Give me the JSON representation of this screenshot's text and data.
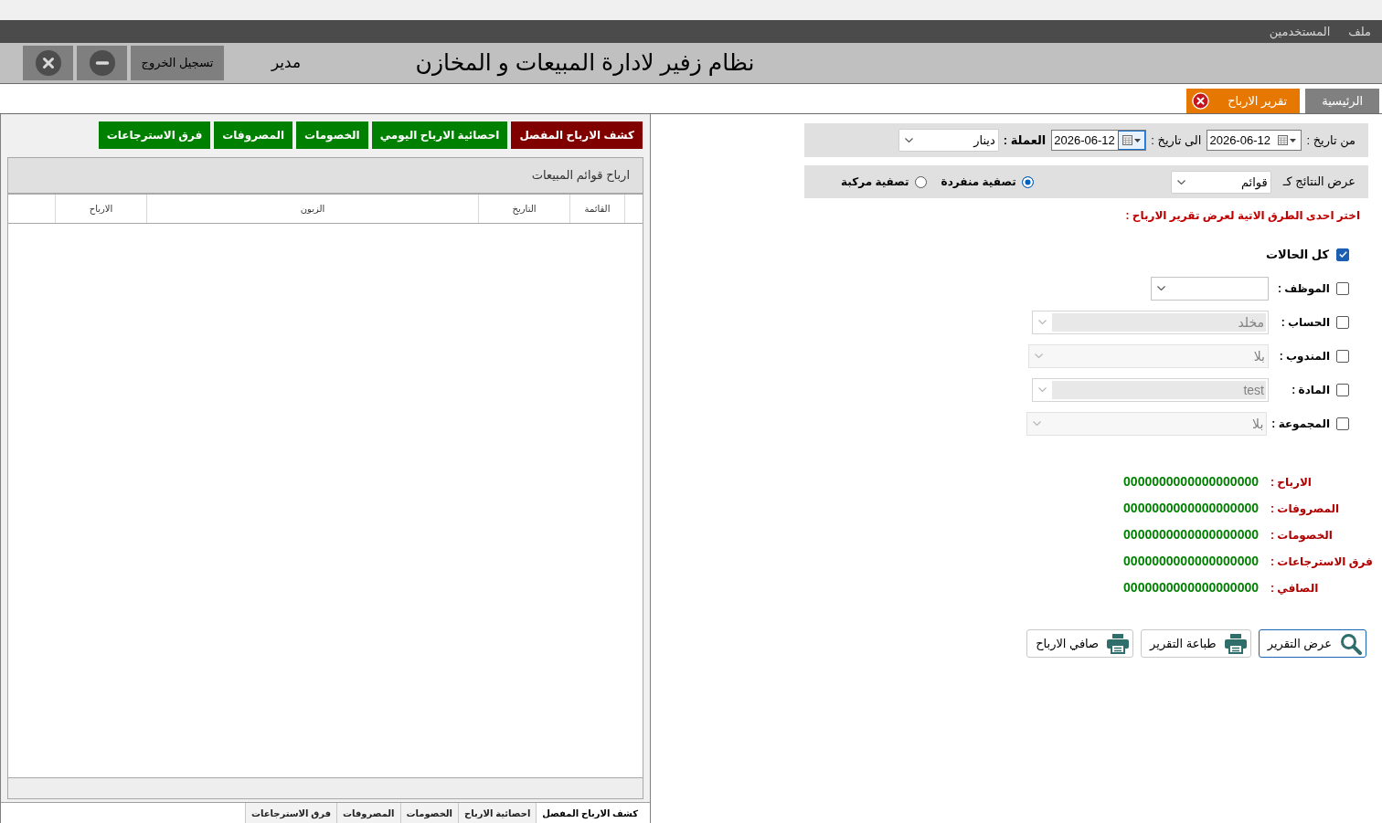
{
  "menu_bar": [
    "ملف",
    "المستخدمين"
  ],
  "header": {
    "title": "نظام زفير لادارة المبيعات و المخازن",
    "user": "مدير",
    "logout_button": "تسجيل الخروج"
  },
  "tabs": [
    {
      "label": "الرئيسية",
      "selected": false,
      "closable": false
    },
    {
      "label": "تقرير الارباح",
      "selected": true,
      "closable": true
    }
  ],
  "filters": {
    "from_date": {
      "label": "من تاريخ :",
      "value": "2026-06-12",
      "focused": false
    },
    "to_date": {
      "label": "الى تاريخ :",
      "value": "2026-06-12",
      "focused": true
    },
    "currency": {
      "label": "العملة :",
      "value": "دينار"
    }
  },
  "display": {
    "label": "عرض النتائج كـ",
    "value": "قوائم",
    "options": [
      {
        "label": "تصفية منفردة",
        "selected": true
      },
      {
        "label": "تصفية مركبة",
        "selected": false
      }
    ]
  },
  "instruction": "اختر احدى الطرق الاتية لعرض تقرير الارباح :",
  "criteria": [
    {
      "kind": "checkbox",
      "label": "كل الحالات",
      "checked": true
    },
    {
      "kind": "dropdown",
      "label": "الموظف :",
      "checked": false,
      "disabled": false
    },
    {
      "kind": "combo",
      "label": "الحساب :",
      "checked": false,
      "disabled": true,
      "value": "مخلد"
    },
    {
      "kind": "dropdown",
      "label": "المندوب :",
      "checked": false,
      "disabled": true,
      "value": "بلا"
    },
    {
      "kind": "combo",
      "label": "المادة :",
      "checked": false,
      "disabled": true,
      "value": "test"
    },
    {
      "kind": "dropdown",
      "label": "المجموعة :",
      "checked": false,
      "disabled": true,
      "value": "بلا"
    }
  ],
  "summary": [
    {
      "label": "الارباح :",
      "value": "0000000000000000000"
    },
    {
      "label": "المصروفات :",
      "value": "0000000000000000000"
    },
    {
      "label": "الخصومات :",
      "value": "0000000000000000000"
    },
    {
      "label": "فرق الاسترجاعات :",
      "value": "0000000000000000000"
    },
    {
      "label": "الصافي :",
      "value": "0000000000000000000"
    }
  ],
  "actions": [
    {
      "kind": "search",
      "label": "عرض التقرير",
      "focused": true
    },
    {
      "kind": "print",
      "label": "طباعة التقرير",
      "focused": false
    },
    {
      "kind": "print",
      "label": "صافي الارباح",
      "focused": false
    }
  ],
  "report_panel": {
    "tabs": [
      {
        "label": "كشف الارباح المفصل",
        "selected": true
      },
      {
        "label": "احصائية الارباح اليومي",
        "selected": false
      },
      {
        "label": "الخصومات",
        "selected": false
      },
      {
        "label": "المصروفات",
        "selected": false
      },
      {
        "label": "فرق الاسترجاعات",
        "selected": false
      }
    ],
    "title": "ارباح قوائم المبيعات",
    "table": {
      "columns": [
        "القائمة",
        "التاريخ",
        "الزبون",
        "الارباح"
      ]
    },
    "bottom_tabs": [
      {
        "label": "كشف الارباح المفصل",
        "selected": true
      },
      {
        "label": "احصائية الارباح",
        "selected": false
      },
      {
        "label": "الخصومات",
        "selected": false
      },
      {
        "label": "المصروفات",
        "selected": false
      },
      {
        "label": "فرق الاسترجاعات",
        "selected": false
      }
    ]
  }
}
